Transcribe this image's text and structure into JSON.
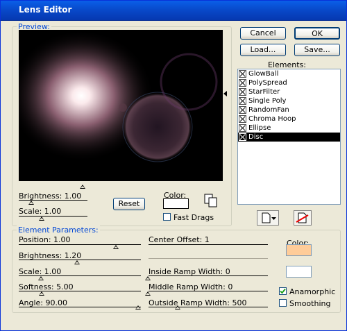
{
  "window": {
    "title": "Lens Editor"
  },
  "preview": {
    "legend": "Preview:",
    "brightness_label": "Brightness: 1.00",
    "scale_label": "Scale: 1.00",
    "reset_label": "Reset",
    "color_label": "Color:",
    "fast_drags_label": "Fast Drags"
  },
  "buttons": {
    "cancel": "Cancel",
    "ok": "OK",
    "load": "Load...",
    "save": "Save..."
  },
  "elements": {
    "label": "Elements:",
    "items": [
      "GlowBall",
      "PolySpread",
      "StarFilter",
      "Single Poly",
      "RandomFan",
      "Chroma Hoop",
      "Ellipse",
      "Disc"
    ],
    "selected": "Disc"
  },
  "params": {
    "legend": "Element Parameters:",
    "position": "Position:  1.00",
    "brightness": "Brightness:  1.20",
    "scale": "Scale:  1.00",
    "softness": "Softness:  5.00",
    "angle": "Angle:  90.00",
    "center_offset": "Center Offset:  1",
    "inside_ramp": "Inside Ramp Width:  0",
    "middle_ramp": "Middle Ramp Width:  0",
    "outside_ramp": "Outside Ramp Width:  500",
    "color_label": "Color:",
    "anamorphic_label": "Anamorphic",
    "smoothing_label": "Smoothing",
    "anamorphic_checked": true,
    "smoothing_checked": false
  },
  "colors": {
    "element_color": "#ffcc99",
    "preview_color": "#ffffff",
    "accent": "#0046d5"
  }
}
